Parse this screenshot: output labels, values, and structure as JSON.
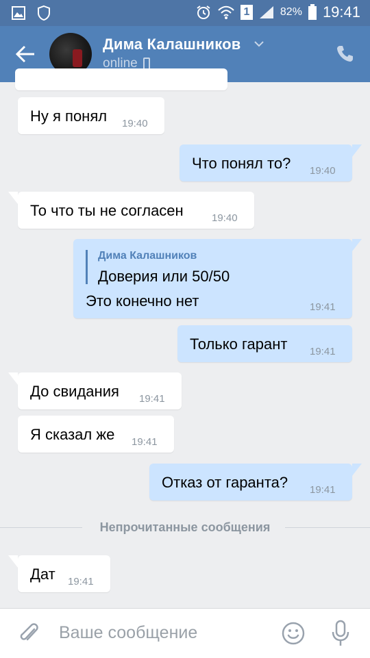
{
  "status_bar": {
    "battery": "82%",
    "time": "19:41",
    "sim_badge": "1"
  },
  "header": {
    "contact_name": "Дима Калашников",
    "status": "online"
  },
  "messages": [
    {
      "direction": "in",
      "text": "Ну я понял",
      "time": "19:40"
    },
    {
      "direction": "out",
      "text": "Что понял то?",
      "time": "19:40"
    },
    {
      "direction": "in",
      "text": "То что ты не согласен",
      "time": "19:40"
    },
    {
      "direction": "out",
      "quote_author": "Дима Калашников",
      "quote_text": "Доверия или 50/50",
      "text": "Это конечно нет",
      "time": "19:41"
    },
    {
      "direction": "out",
      "text": "Только гарант",
      "time": "19:41"
    },
    {
      "direction": "in",
      "text": "До свидания",
      "time": "19:41"
    },
    {
      "direction": "in",
      "text": "Я сказал же",
      "time": "19:41"
    },
    {
      "direction": "out",
      "text": "Отказ от гаранта?",
      "time": "19:41"
    },
    {
      "direction": "in",
      "text": "Дат",
      "time": "19:41"
    }
  ],
  "unread_divider": "Непрочитанные сообщения",
  "composer": {
    "placeholder": "Ваше сообщение"
  },
  "colors": {
    "header": "#5181b8",
    "status_bar": "#4e75a6",
    "outgoing_bubble": "#cce4ff",
    "background": "#edeef0"
  }
}
